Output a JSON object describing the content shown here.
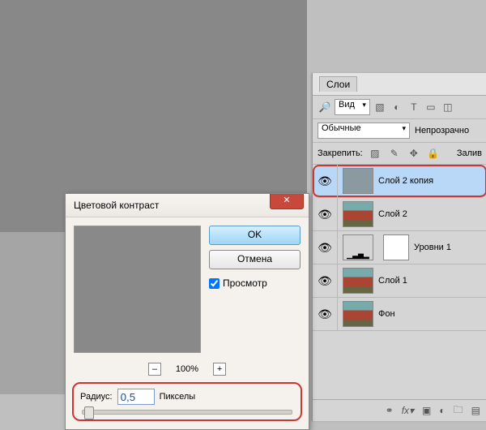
{
  "dialog": {
    "title": "Цветовой контраст",
    "ok": "OK",
    "cancel": "Отмена",
    "preview_label": "Просмотр",
    "zoom_pct": "100%",
    "radius_label": "Радиус:",
    "radius_value": "0,5",
    "radius_unit": "Пикселы"
  },
  "panel": {
    "tab": "Слои",
    "filter_label": "Вид",
    "blend_mode": "Обычные",
    "opacity_label": "Непрозрачно",
    "lock_label": "Закрепить:",
    "fill_label": "Залив"
  },
  "layers": [
    {
      "name": "Слой 2 копия",
      "selected": true,
      "kind": "image"
    },
    {
      "name": "Слой 2",
      "selected": false,
      "kind": "car"
    },
    {
      "name": "Уровни 1",
      "selected": false,
      "kind": "levels"
    },
    {
      "name": "Слой 1",
      "selected": false,
      "kind": "car"
    },
    {
      "name": "Фон",
      "selected": false,
      "kind": "car"
    }
  ]
}
